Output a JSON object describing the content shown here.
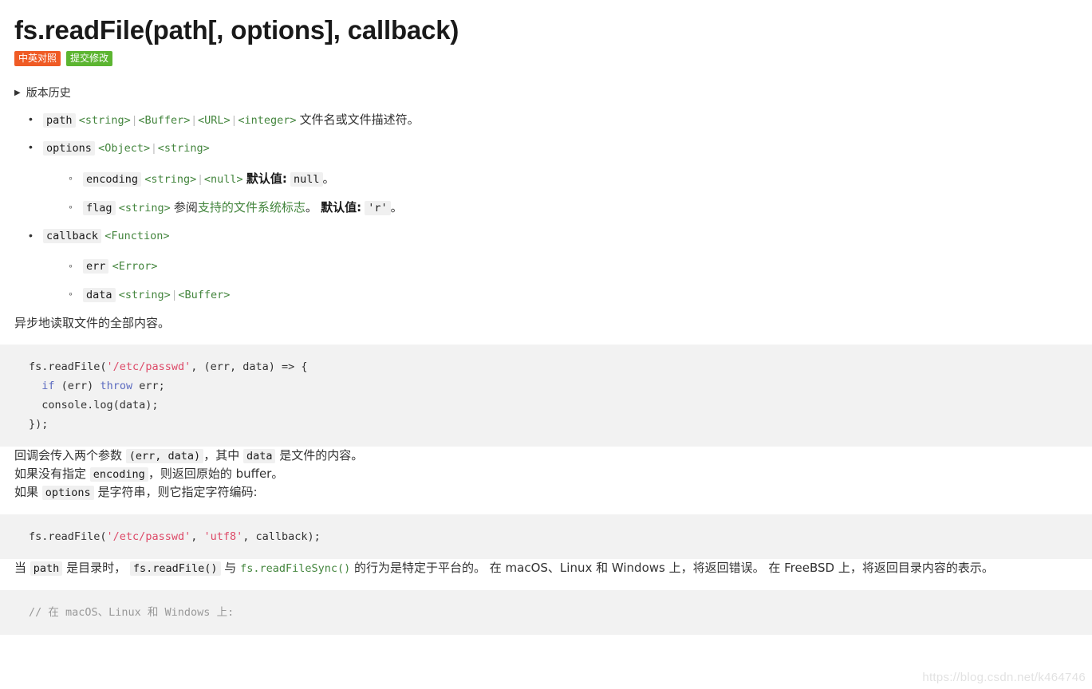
{
  "header": {
    "title": "fs.readFile(path[, options], callback)",
    "badges": [
      {
        "label": "中英对照",
        "color": "#ef5b25",
        "name": "compare"
      },
      {
        "label": "提交修改",
        "color": "#5cb531",
        "name": "edit"
      }
    ]
  },
  "version_history": {
    "marker": "▶",
    "label": "版本历史"
  },
  "params": {
    "path": {
      "name": "path",
      "types": [
        "<string>",
        "<Buffer>",
        "<URL>",
        "<integer>"
      ],
      "description": "文件名或文件描述符。"
    },
    "options": {
      "name": "options",
      "types": [
        "<Object>",
        "<string>"
      ],
      "children": {
        "encoding": {
          "name": "encoding",
          "types": [
            "<string>",
            "<null>"
          ],
          "default_label": "默认值:",
          "default_value": "null",
          "trailing": "。"
        },
        "flag": {
          "name": "flag",
          "types": [
            "<string>"
          ],
          "see_label": "参阅",
          "link_text": "支持的文件系统标志",
          "link_suffix": "。",
          "default_label": "默认值:",
          "default_value": "'r'",
          "trailing": "。"
        }
      }
    },
    "callback": {
      "name": "callback",
      "types": [
        "<Function>"
      ],
      "children": {
        "err": {
          "name": "err",
          "types": [
            "<Error>"
          ]
        },
        "data": {
          "name": "data",
          "types": [
            "<string>",
            "<Buffer>"
          ]
        }
      }
    }
  },
  "separator": "|",
  "body": {
    "intro": "异步地读取文件的全部内容。",
    "code_1": {
      "lines": [
        [
          {
            "t": "fs.readFile(",
            "c": "plain"
          },
          {
            "t": "'/etc/passwd'",
            "c": "str"
          },
          {
            "t": ", (err, data) => {",
            "c": "plain"
          }
        ],
        [
          {
            "t": "  ",
            "c": "plain"
          },
          {
            "t": "if",
            "c": "kw"
          },
          {
            "t": " (err) ",
            "c": "plain"
          },
          {
            "t": "throw",
            "c": "kw"
          },
          {
            "t": " err;",
            "c": "plain"
          }
        ],
        [
          {
            "t": "  console.log(data);",
            "c": "plain"
          }
        ],
        [
          {
            "t": "});",
            "c": "plain"
          }
        ]
      ]
    },
    "p_callback": {
      "before": "回调会传入两个参数 ",
      "code1": "(err, data)",
      "middle": "，其中 ",
      "code2": "data",
      "after": " 是文件的内容。"
    },
    "p_encoding": {
      "before": "如果没有指定 ",
      "code1": "encoding",
      "after": "，则返回原始的 buffer。"
    },
    "p_options": {
      "before": "如果 ",
      "code1": "options",
      "after": " 是字符串，则它指定字符编码:"
    },
    "code_2": {
      "lines": [
        [
          {
            "t": "fs.readFile(",
            "c": "plain"
          },
          {
            "t": "'/etc/passwd'",
            "c": "str"
          },
          {
            "t": ", ",
            "c": "plain"
          },
          {
            "t": "'utf8'",
            "c": "str"
          },
          {
            "t": ", callback);",
            "c": "plain"
          }
        ]
      ]
    },
    "p_directory": {
      "s1": "当 ",
      "code1": "path",
      "s2": " 是目录时， ",
      "code2": "fs.readFile()",
      "s3": " 与 ",
      "link1": "fs.readFileSync()",
      "s4": " 的行为是特定于平台的。 在 macOS、Linux 和 Windows 上，将返回错误。 在 FreeBSD 上，将返回目录内容的表示。"
    },
    "code_3": {
      "lines": [
        [
          {
            "t": "// 在 macOS、Linux 和 Windows 上:",
            "c": "cm"
          }
        ]
      ]
    }
  },
  "watermark": "https://blog.csdn.net/k464746"
}
